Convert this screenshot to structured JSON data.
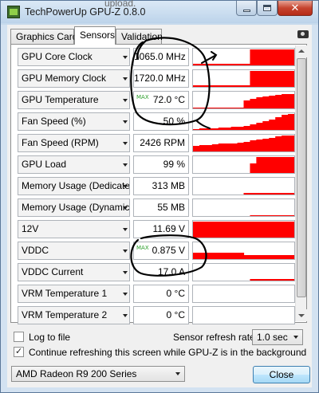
{
  "window": {
    "title": "TechPowerUp GPU-Z 0.8.0",
    "ghost_text": "upload."
  },
  "tabs": [
    {
      "label": "Graphics Card",
      "active": false
    },
    {
      "label": "Sensors",
      "active": true
    },
    {
      "label": "Validation",
      "active": false
    }
  ],
  "sensors": [
    {
      "name": "GPU Core Clock",
      "value": "1065.0 MHz",
      "graph": [
        0.08,
        0.08,
        0.08,
        0.08,
        0.08,
        0.08,
        0.08,
        0.08,
        0.08,
        1,
        1,
        1,
        1,
        1,
        1,
        1
      ]
    },
    {
      "name": "GPU Memory Clock",
      "value": "1720.0 MHz",
      "graph": [
        0.08,
        0.08,
        0.08,
        0.08,
        0.08,
        0.08,
        0.08,
        0.08,
        0.08,
        1,
        1,
        1,
        1,
        1,
        1,
        1
      ]
    },
    {
      "name": "GPU Temperature",
      "value": "72.0 °C",
      "max": true,
      "graph": [
        0.05,
        0.05,
        0.05,
        0.05,
        0.05,
        0.05,
        0.05,
        0.05,
        0.5,
        0.6,
        0.7,
        0.75,
        0.8,
        0.85,
        0.88,
        0.9
      ]
    },
    {
      "name": "Fan Speed (%)",
      "value": "50 %",
      "graph": [
        0.05,
        0.08,
        0.1,
        0.12,
        0.14,
        0.16,
        0.18,
        0.2,
        0.25,
        0.35,
        0.45,
        0.55,
        0.65,
        0.8,
        0.95,
        1
      ]
    },
    {
      "name": "Fan Speed (RPM)",
      "value": "2426 RPM",
      "graph": [
        0.35,
        0.4,
        0.42,
        0.45,
        0.48,
        0.5,
        0.52,
        0.55,
        0.6,
        0.7,
        0.75,
        0.8,
        0.85,
        0.95,
        1,
        1
      ]
    },
    {
      "name": "GPU Load",
      "value": "99 %",
      "graph": [
        0,
        0,
        0,
        0,
        0,
        0,
        0,
        0,
        0,
        0.6,
        1,
        1,
        1,
        1,
        1,
        1
      ]
    },
    {
      "name": "Memory Usage (Dedicated)",
      "value": "313 MB",
      "graph": [
        0,
        0,
        0,
        0,
        0,
        0,
        0,
        0,
        0.1,
        0.12,
        0.12,
        0.12,
        0.12,
        0.12,
        0.12,
        0.12
      ]
    },
    {
      "name": "Memory Usage (Dynamic)",
      "value": "55 MB",
      "graph": [
        0,
        0,
        0,
        0,
        0,
        0,
        0,
        0,
        0,
        0.06,
        0.06,
        0.06,
        0.06,
        0.06,
        0.06,
        0.06
      ]
    },
    {
      "name": "12V",
      "value": "11.69 V",
      "graph": [
        1,
        1,
        1,
        1,
        1,
        1,
        1,
        1,
        1,
        1,
        1,
        1,
        1,
        1,
        1,
        1
      ]
    },
    {
      "name": "VDDC",
      "value": "0.875 V",
      "max": true,
      "graph": [
        0.4,
        0.4,
        0.4,
        0.4,
        0.4,
        0.4,
        0.4,
        0.4,
        0.25,
        0.25,
        0.25,
        0.25,
        0.25,
        0.25,
        0.25,
        0.25
      ]
    },
    {
      "name": "VDDC Current",
      "value": "17.0 A",
      "graph": [
        0,
        0,
        0,
        0,
        0,
        0,
        0,
        0,
        0,
        0.12,
        0.12,
        0.12,
        0.12,
        0.12,
        0.12,
        0.12
      ]
    },
    {
      "name": "VRM Temperature 1",
      "value": "0 °C",
      "graph": []
    },
    {
      "name": "VRM Temperature 2",
      "value": "0 °C",
      "graph": []
    }
  ],
  "max_tag": "MAX",
  "options": {
    "log_to_file_label": "Log to file",
    "log_to_file_checked": false,
    "continue_label": "Continue refreshing this screen while GPU-Z is in the background",
    "continue_checked": true,
    "refresh_rate_label": "Sensor refresh rate:",
    "refresh_rate_value": "1.0 sec"
  },
  "footer": {
    "gpu_selected": "AMD Radeon R9 200 Series",
    "close_label": "Close"
  },
  "colors": {
    "graph": "#ff0000",
    "max_tag": "#2fa02f",
    "annotation": "#000000"
  }
}
